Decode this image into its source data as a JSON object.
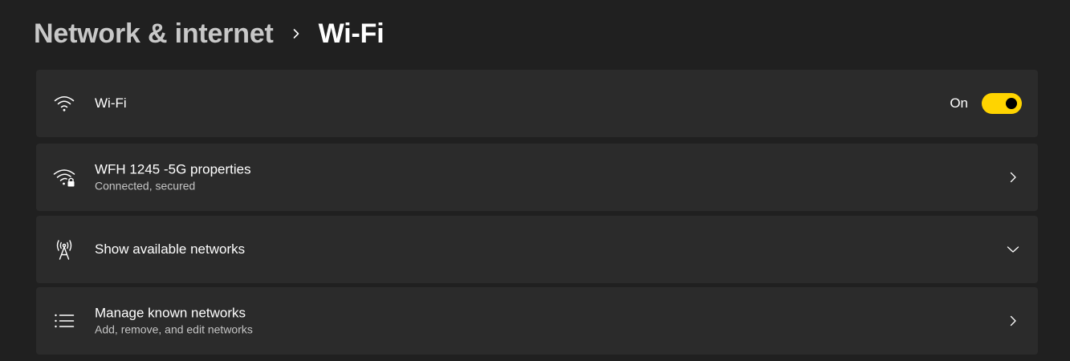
{
  "breadcrumb": {
    "parent": "Network & internet",
    "current": "Wi-Fi"
  },
  "wifi_toggle_row": {
    "title": "Wi-Fi",
    "state_label": "On",
    "is_on": true,
    "icon": "wifi-icon"
  },
  "properties_row": {
    "title": "WFH 1245 -5G properties",
    "subtitle": "Connected, secured",
    "icon": "wifi-secured-icon"
  },
  "available_row": {
    "title": "Show available networks",
    "icon": "antenna-icon"
  },
  "known_row": {
    "title": "Manage known networks",
    "subtitle": "Add, remove, and edit networks",
    "icon": "list-icon"
  },
  "colors": {
    "background": "#202020",
    "card": "#2b2b2b",
    "accent": "#ffd400"
  }
}
